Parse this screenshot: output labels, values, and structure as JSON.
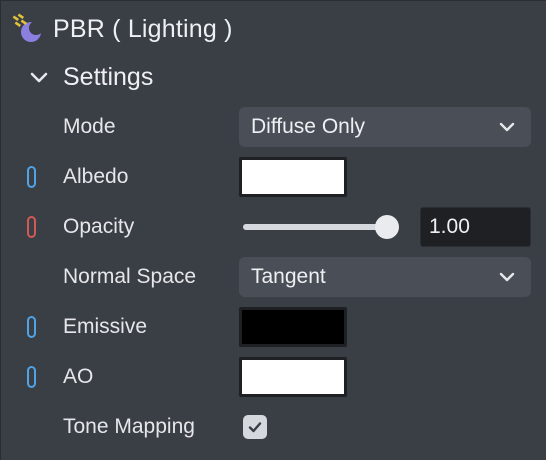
{
  "node": {
    "title": "PBR ( Lighting )",
    "icon": "pbr-node-icon"
  },
  "section": {
    "title": "Settings",
    "expanded": true
  },
  "rows": {
    "mode": {
      "label": "Mode",
      "value": "Diffuse Only"
    },
    "albedo": {
      "label": "Albedo",
      "color": "#ffffff"
    },
    "opacity": {
      "label": "Opacity",
      "value": "1.00",
      "level": 1.0
    },
    "normal_space": {
      "label": "Normal Space",
      "value": "Tangent"
    },
    "emissive": {
      "label": "Emissive",
      "color": "#000000"
    },
    "ao": {
      "label": "AO",
      "color": "#ffffff"
    },
    "tone_mapping": {
      "label": "Tone Mapping",
      "checked": true
    }
  },
  "colors": {
    "panel_bg": "#3a3e45",
    "pin_blue": "#4fa3e6",
    "pin_red": "#d25a55",
    "dropdown_bg": "#4a4e56"
  }
}
